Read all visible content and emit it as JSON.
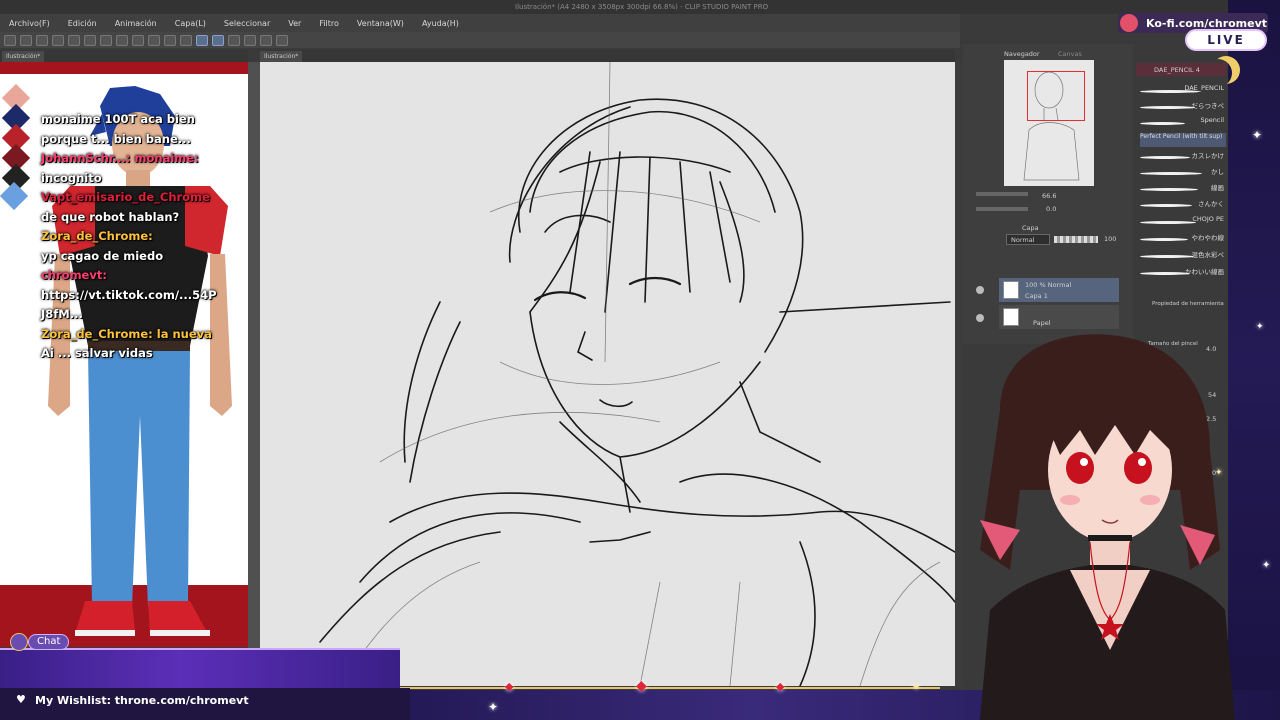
{
  "window": {
    "title": "Ilustración* (A4 2480 x 3508px 300dpi 66.8%) - CLIP STUDIO PAINT PRO"
  },
  "menu": {
    "items": [
      "Archivo(F)",
      "Edición",
      "Animación",
      "Capa(L)",
      "Seleccionar",
      "Ver",
      "Filtro",
      "Ventana(W)",
      "Ayuda(H)"
    ]
  },
  "tabs": {
    "left_tab": "Ilustración*",
    "canvas_tab": "Ilustración*"
  },
  "chat": {
    "lines": [
      {
        "text": "monaime 100T aca bien",
        "cls": ""
      },
      {
        "text": "porque t... bien bane...",
        "cls": ""
      },
      {
        "text": "JohannSchr...: monaime:",
        "cls": "user-pink"
      },
      {
        "text": "incognito",
        "cls": ""
      },
      {
        "text": "Vapt_emisario_de_Chrome",
        "cls": "user-red"
      },
      {
        "text": "de que robot hablan?",
        "cls": ""
      },
      {
        "text": "Zora_de_Chrome:",
        "cls": "user-gold"
      },
      {
        "text": "yp cagao de miedo",
        "cls": ""
      },
      {
        "text": "chromevt:",
        "cls": "user-pink"
      },
      {
        "text": "https://vt.tiktok.com/...54P",
        "cls": ""
      },
      {
        "text": "J8fM...",
        "cls": ""
      },
      {
        "text": "Zora_de_Chrome: la nueva",
        "cls": "user-gold"
      },
      {
        "text": "Ai ... salvar vidas",
        "cls": ""
      }
    ],
    "badge": "Chat"
  },
  "navigator": {
    "label": "Navegador",
    "label2": "Canvas",
    "zoom": "66.6",
    "rotation": "0.0"
  },
  "layers": {
    "label": "Capa",
    "blend_mode": "Normal",
    "opacity": "100",
    "items": [
      {
        "name": "100 % Normal",
        "sub": "Capa 1"
      },
      {
        "name": "",
        "sub": "Papel"
      }
    ]
  },
  "brushes": {
    "header": "DAE_PENCIL 4",
    "items": [
      "DAE_PENCIL",
      "だらつきペ",
      "Spencil",
      "Perfect Pencil (with tilt sup)",
      "カスレかけ",
      "かし",
      "線画",
      "さんかく",
      "CHOJO PE",
      "やわやわ線",
      "混色水彩ペ",
      "かわいい線画"
    ],
    "properties_label": "Propiedad de herramienta",
    "size_label": "Tamaño del pincel",
    "size_value": "4.0",
    "value2": "54",
    "value3": "2.5",
    "value4": "0"
  },
  "overlay": {
    "kofi": "Ko-fi.com/chromevt",
    "live": "LIVE",
    "wishlist": "My Wishlist: throne.com/chromevt"
  },
  "colors": {
    "accent_red": "#a3141d",
    "purple": "#5b2fb8",
    "gold": "#e8c46a"
  }
}
